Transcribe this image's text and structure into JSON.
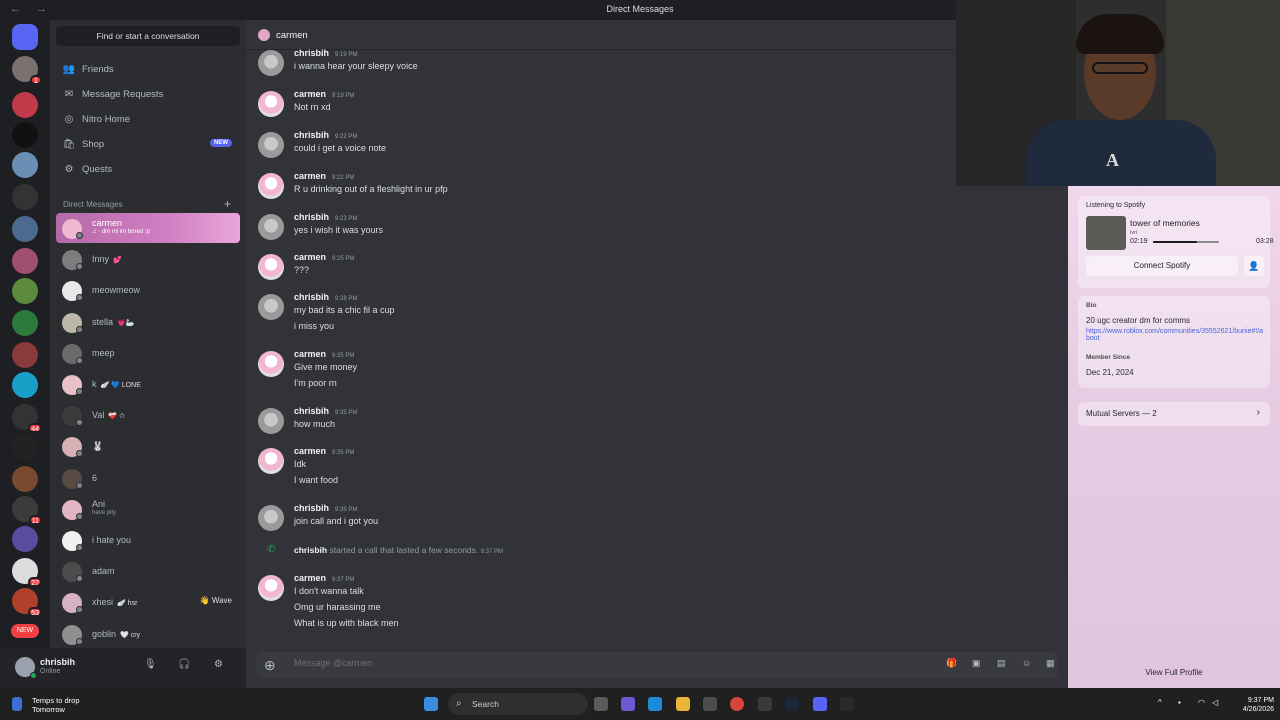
{
  "window": {
    "title": "Direct Messages",
    "nav_arrows": "← →"
  },
  "dm_panel": {
    "find_placeholder": "Find or start a conversation",
    "nav": [
      {
        "label": "Friends",
        "icon": "friends-icon",
        "glyph": "👥"
      },
      {
        "label": "Message Requests",
        "icon": "envelope-icon",
        "glyph": "✉"
      },
      {
        "label": "Nitro Home",
        "icon": "nitro-icon",
        "glyph": "◎"
      },
      {
        "label": "Shop",
        "icon": "shop-icon",
        "glyph": "🛍",
        "badge": "NEW"
      },
      {
        "label": "Quests",
        "icon": "quests-icon",
        "glyph": "⚙"
      }
    ],
    "dm_header": "Direct Messages",
    "add_dm": "+",
    "dms": [
      {
        "name": "carmen",
        "sub": "♫ · dm mi im bored :p",
        "active": true,
        "avatar_color": "#f1b8d2"
      },
      {
        "name": "Inny",
        "tag": "💕",
        "avatar_color": "#7d7d7d"
      },
      {
        "name": "meowmeow",
        "avatar_color": "#e8e8e8"
      },
      {
        "name": "stella",
        "tag": "💗🦢",
        "avatar_color": "#bdb7a8"
      },
      {
        "name": "meep",
        "avatar_color": "#6a6a6a"
      },
      {
        "name": "k",
        "tag": "🪽 💙 LONE",
        "avatar_color": "#e9c2c9"
      },
      {
        "name": "Val",
        "tag": "❤️‍🩹 ✩",
        "avatar_color": "#3b3b3b"
      },
      {
        "name": "🐰",
        "avatar_color": "#d8b1b5"
      },
      {
        "name": "6",
        "avatar_color": "#5a4a44"
      },
      {
        "name": "Ani",
        "sub": "have pity",
        "avatar_color": "#e3b4c2"
      },
      {
        "name": "i hate you",
        "avatar_color": "#f0f0f0"
      },
      {
        "name": "adam",
        "avatar_color": "#4c4c4c"
      },
      {
        "name": "xhesi",
        "tag": "🪽 hsr",
        "avatar_color": "#d7b2c3",
        "right": "👋 Wave"
      },
      {
        "name": "goblin",
        "tag": "🤍 cry",
        "avatar_color": "#8f8f8f"
      }
    ]
  },
  "user_panel": {
    "name": "chrisbih",
    "status": "Online",
    "mic": "🎙",
    "headset": "🎧",
    "settings": "⚙"
  },
  "chat": {
    "recipient": "carmen",
    "messages": [
      {
        "author": "chrisbih",
        "time": "9:19 PM",
        "lines": [
          "i wanna hear your sleepy voice"
        ]
      },
      {
        "author": "carmen",
        "time": "9:19 PM",
        "lines": [
          "Not rn xd"
        ]
      },
      {
        "author": "chrisbih",
        "time": "9:22 PM",
        "lines": [
          "could i get a voice note"
        ]
      },
      {
        "author": "carmen",
        "time": "9:22 PM",
        "lines": [
          "R u drinking out of a fleshlight in ur pfp"
        ]
      },
      {
        "author": "chrisbih",
        "time": "9:23 PM",
        "lines": [
          "yes i wish it was yours"
        ]
      },
      {
        "author": "carmen",
        "time": "9:25 PM",
        "lines": [
          "???"
        ]
      },
      {
        "author": "chrisbih",
        "time": "9:28 PM",
        "lines": [
          "my bad its a chic fil a cup",
          "i miss you"
        ]
      },
      {
        "author": "carmen",
        "time": "9:35 PM",
        "lines": [
          "Give me money",
          "I'm poor rn"
        ]
      },
      {
        "author": "chrisbih",
        "time": "9:35 PM",
        "lines": [
          "how much"
        ]
      },
      {
        "author": "carmen",
        "time": "9:35 PM",
        "lines": [
          "Idk",
          "I want food"
        ]
      },
      {
        "author": "chrisbih",
        "time": "9:35 PM",
        "lines": [
          "join call and i got you"
        ]
      },
      {
        "author": "carmen",
        "time": "9:37 PM",
        "lines": [
          "I don't wanna talk",
          "Omg ur harassing me",
          "What is up with black men"
        ]
      }
    ],
    "call": {
      "author": "chrisbih",
      "text": "started a call that lasted a few seconds.",
      "time": "9:37 PM"
    },
    "composer_placeholder": "Message @carmen"
  },
  "profile": {
    "activity_label": "Listening to Spotify",
    "track": "tower of memories",
    "artist": "ivri",
    "elapsed": "02:19",
    "duration": "03:28",
    "progress": 0.668,
    "connect_label": "Connect Spotify",
    "bio_label": "Bio",
    "bio_text": "20 ugc creator dm for comms",
    "bio_link": "https://www.roblox.com/communities/35552621/bunie#!/about",
    "member_since_label": "Member Since",
    "member_since": "Dec 21, 2024",
    "mutual_servers": "Mutual Servers — 2",
    "view_full_profile": "View Full Profile"
  },
  "taskbar": {
    "weather_line1": "Temps to drop",
    "weather_line2": "Tomorrow",
    "search_label": "Search",
    "time": "9:37 PM",
    "date": "4/26/2026"
  },
  "colors": {
    "accent": "#5865f2",
    "online": "#23a55a",
    "danger": "#f23f43",
    "active_dm": "#d07ec3"
  }
}
